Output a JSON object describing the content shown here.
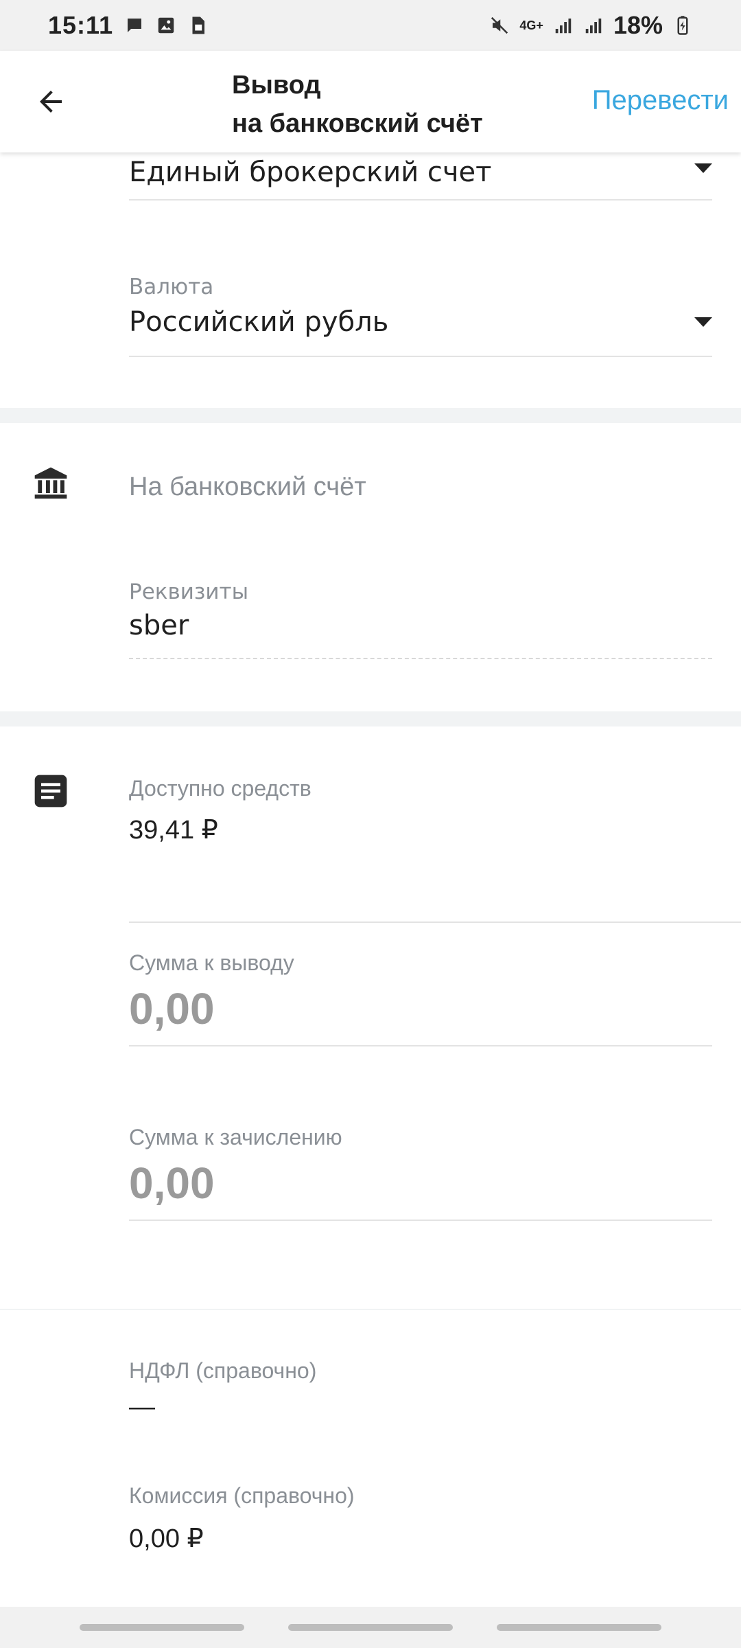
{
  "status_bar": {
    "time": "15:11",
    "network": "4G+",
    "battery": "18%"
  },
  "header": {
    "title_line1": "Вывод",
    "title_line2": "на банковский счёт",
    "action_label": "Перевести",
    "accent_color": "#3aa7df"
  },
  "source": {
    "account_value": "Единый брокерский счет",
    "currency_label": "Валюта",
    "currency_value": "Российский рубль"
  },
  "bank": {
    "title": "На банковский счёт",
    "details_label": "Реквизиты",
    "details_value": "sber"
  },
  "amounts": {
    "available_label": "Доступно средств",
    "available_value": "39,41 ₽",
    "withdraw_label": "Сумма к выводу",
    "withdraw_value": "0,00",
    "credit_label": "Сумма к зачислению",
    "credit_value": "0,00"
  },
  "fees": {
    "tax_label": "НДФЛ (справочно)",
    "tax_value": "—",
    "commission_label": "Комиссия (справочно)",
    "commission_value": "0,00 ₽"
  },
  "icons": [
    "back-arrow-icon",
    "bank-icon",
    "document-icon",
    "dropdown-caret-icon"
  ]
}
